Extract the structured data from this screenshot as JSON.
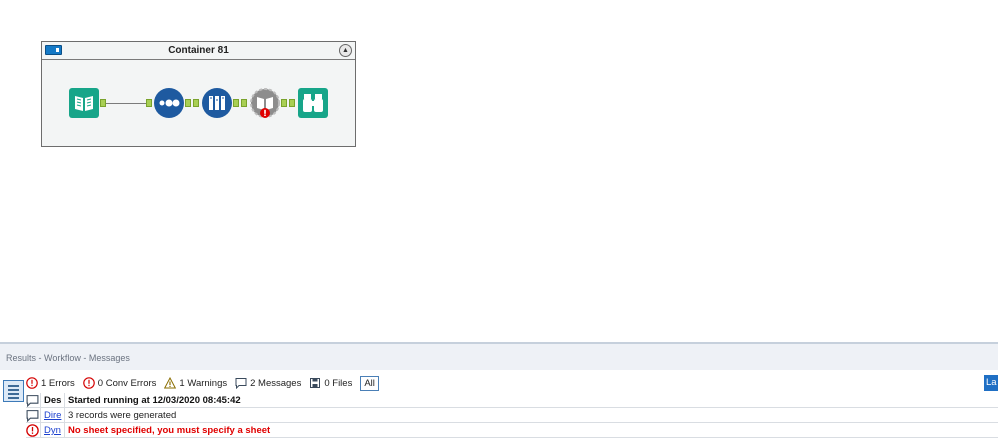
{
  "canvas": {
    "container": {
      "title": "Container 81",
      "collapse_glyph": "▲",
      "tools": [
        {
          "name": "input-data-book-icon",
          "color": "#17a589"
        },
        {
          "name": "record-id-dots-icon",
          "color": "#1e5aa0"
        },
        {
          "name": "select-columns-icon",
          "color": "#1e5aa0"
        },
        {
          "name": "dynamic-input-gear-book-icon",
          "color": "#8d8d8d",
          "has_error": true
        },
        {
          "name": "browse-binoculars-icon",
          "color": "#17a589"
        }
      ]
    }
  },
  "results": {
    "title": "Results - Workflow - Messages",
    "filters": {
      "errors": "1 Errors",
      "conv_errors": "0 Conv Errors",
      "warnings": "1 Warnings",
      "messages": "2 Messages",
      "files": "0 Files",
      "all": "All"
    },
    "layout_button": "La",
    "rows": [
      {
        "type": "message",
        "tool": "Des",
        "text": "Started running at 12/03/2020 08:45:42"
      },
      {
        "type": "message",
        "tool": "Dire",
        "text": "3 records were generated"
      },
      {
        "type": "error",
        "tool": "Dyn",
        "text": "No sheet specified, you must specify a sheet"
      }
    ]
  },
  "colors": {
    "error": "#e00000",
    "accent": "#1f6fc4",
    "anchor": "#a8cf54"
  }
}
